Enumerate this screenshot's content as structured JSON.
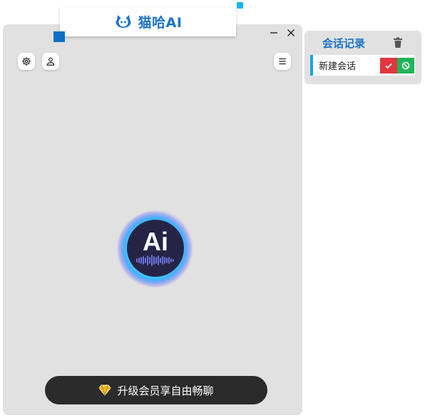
{
  "app": {
    "title": "猫哈AI",
    "logo_icon": "chat-bot-icon",
    "logo_badge": "Ai",
    "accent_color": "#1a73c9"
  },
  "window_controls": {
    "minimize_icon": "minimize-icon",
    "close_icon": "close-icon"
  },
  "toolbar": {
    "settings_icon": "gear-icon",
    "user_icon": "user-icon",
    "menu_icon": "menu-icon"
  },
  "upgrade": {
    "label": "升级会员享自由畅聊",
    "icon": "diamond-icon"
  },
  "history": {
    "title": "会话记录",
    "delete_icon": "trash-icon",
    "sessions": [
      {
        "label": "新建会话",
        "confirm_icon": "check-icon",
        "cancel_icon": "ban-icon"
      }
    ]
  }
}
